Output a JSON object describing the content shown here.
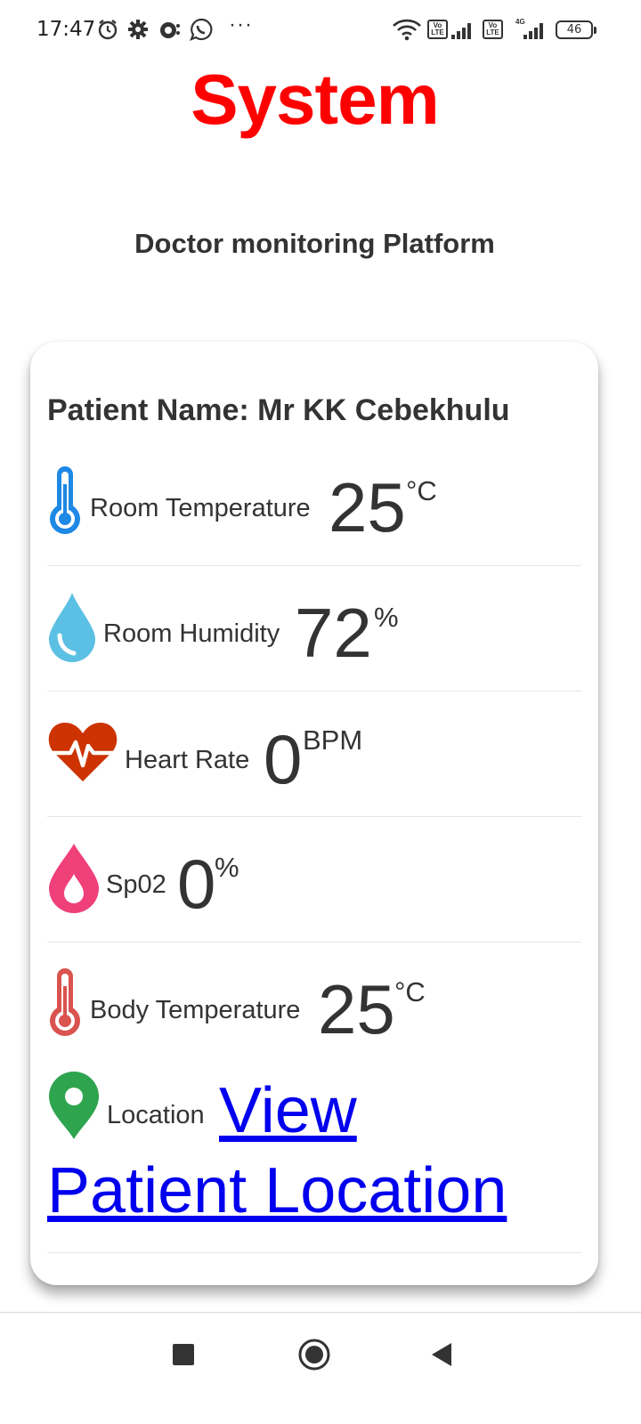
{
  "status_bar": {
    "time": "17:47",
    "icons": [
      "alarm-icon",
      "settings-gear-icon",
      "app-notification-icon",
      "whatsapp-icon",
      "more-dots-icon",
      "wifi-icon",
      "volte-icon",
      "signal-icon",
      "volte-icon",
      "signal-4g-icon",
      "battery-icon"
    ],
    "more": "···",
    "volte": "Vo LTE",
    "network": "4G",
    "battery": "46"
  },
  "header": {
    "title": "System",
    "subtitle": "Doctor monitoring Platform"
  },
  "card": {
    "patient_name": "Patient Name: Mr KK Cebekhulu",
    "room_temperature": {
      "icon": "thermometer-blue-icon",
      "label": "Room Temperature",
      "value": "25",
      "unit": "°C"
    },
    "room_humidity": {
      "icon": "water-drop-icon",
      "label": "Room Humidity",
      "value": "72",
      "unit": "%"
    },
    "heart_rate": {
      "icon": "heart-pulse-icon",
      "label": "Heart Rate",
      "value": "0",
      "unit": "BPM"
    },
    "spo2": {
      "icon": "blood-drop-icon",
      "label": "Sp02",
      "value": "0",
      "unit": "%"
    },
    "body_temperature": {
      "icon": "thermometer-red-icon",
      "label": "Body Temperature",
      "value": "25",
      "unit": "°C"
    },
    "location": {
      "icon": "map-pin-icon",
      "label": "Location",
      "link_line1": "View",
      "link_line2": "Patient Location"
    }
  },
  "colors": {
    "title_red": "#ff0000",
    "link_blue": "#0000ee",
    "text": "#333333"
  },
  "nav": {
    "buttons": [
      "recents-square-icon",
      "home-circle-icon",
      "back-triangle-icon"
    ]
  }
}
